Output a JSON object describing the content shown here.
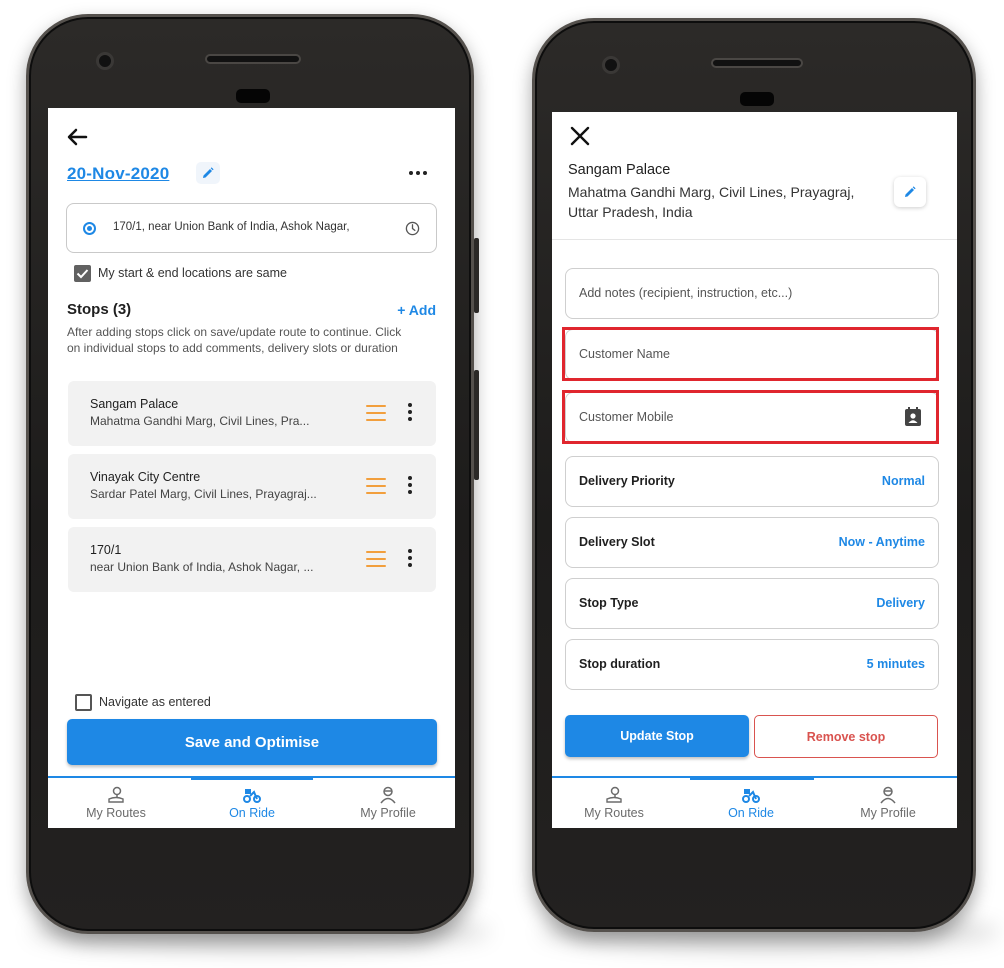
{
  "colors": {
    "accent": "#1e88e5",
    "highlight": "#e0262e",
    "danger": "#d9534f",
    "drag_handle": "#f29f3d"
  },
  "left_screen": {
    "date": "20-Nov-2020",
    "start_location": "170/1, near Union Bank of India, Ashok Nagar,",
    "same_locations_label": "My start & end locations are same",
    "stops_title": "Stops (3)",
    "add_label": "+ Add",
    "stops_help": "After adding stops click on save/update route to continue. Click on individual stops to add comments, delivery slots or duration",
    "stops": [
      {
        "name": "Sangam Palace",
        "address": "Mahatma Gandhi Marg, Civil Lines, Pra..."
      },
      {
        "name": "Vinayak City Centre",
        "address": "Sardar Patel Marg, Civil Lines, Prayagraj..."
      },
      {
        "name": "170/1",
        "address": "near Union Bank of India, Ashok Nagar, ..."
      }
    ],
    "navigate_label": "Navigate as entered",
    "save_button": "Save and Optimise"
  },
  "right_screen": {
    "stop_title": "Sangam Palace",
    "stop_address": "Mahatma Gandhi Marg, Civil Lines, Prayagraj, Uttar Pradesh, India",
    "notes_placeholder": "Add notes (recipient, instruction, etc...)",
    "customer_name_placeholder": "Customer Name",
    "customer_mobile_placeholder": "Customer Mobile",
    "settings": [
      {
        "label": "Delivery Priority",
        "value": "Normal"
      },
      {
        "label": "Delivery Slot",
        "value": "Now - Anytime"
      },
      {
        "label": "Stop Type",
        "value": "Delivery"
      },
      {
        "label": "Stop duration",
        "value": "5 minutes"
      }
    ],
    "update_button": "Update Stop",
    "remove_button": "Remove stop"
  },
  "nav": {
    "items": [
      {
        "label": "My Routes",
        "icon": "map-pin-icon"
      },
      {
        "label": "On Ride",
        "icon": "bike-icon"
      },
      {
        "label": "My Profile",
        "icon": "profile-icon"
      }
    ],
    "active": "On Ride"
  }
}
